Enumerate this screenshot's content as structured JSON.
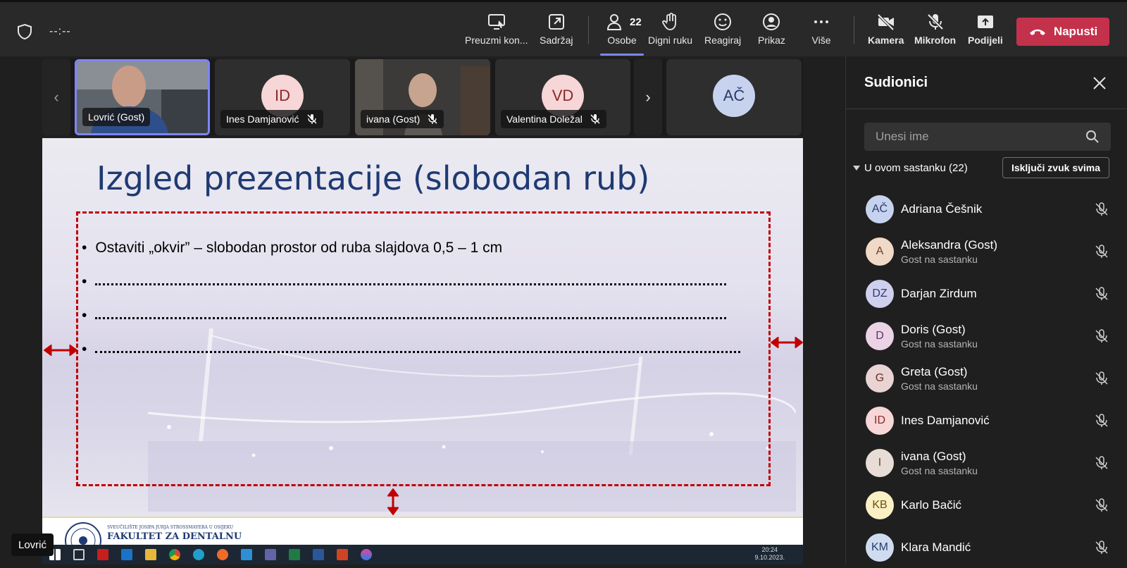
{
  "topbar": {
    "timer": "--:--",
    "buttons": [
      {
        "label": "Preuzmi kon...",
        "icon": "take-control-icon"
      },
      {
        "label": "Sadržaj",
        "icon": "share-tray-icon"
      },
      {
        "label": "Osobe",
        "icon": "people-icon",
        "count": "22"
      },
      {
        "label": "Digni ruku",
        "icon": "raise-hand-icon"
      },
      {
        "label": "Reagiraj",
        "icon": "smile-icon"
      },
      {
        "label": "Prikaz",
        "icon": "view-icon"
      },
      {
        "label": "Više",
        "icon": "more-icon"
      },
      {
        "label": "Kamera",
        "icon": "camera-off-icon"
      },
      {
        "label": "Mikrofon",
        "icon": "mic-off-icon"
      },
      {
        "label": "Podijeli",
        "icon": "share-icon"
      }
    ],
    "leave_label": "Napusti",
    "leave_color": "#c4314b"
  },
  "tiles": [
    {
      "name": "Lovrić (Gost)",
      "initials": "",
      "muted": false
    },
    {
      "name": "Ines Damjanović",
      "initials": "ID",
      "muted": true
    },
    {
      "name": "ivana (Gost)",
      "initials": "",
      "muted": true
    },
    {
      "name": "Valentina Doležal",
      "initials": "VD",
      "muted": true
    },
    {
      "name": "",
      "initials": "AČ",
      "muted": false
    }
  ],
  "slide": {
    "title": "Izgled prezentacije (slobodan rub)",
    "bullets": [
      "Ostaviti „okvir” – slobodan prostor od ruba slajdova 0,5 – 1 cm",
      "",
      "",
      ""
    ],
    "footer_university": "SVEUČILIŠTE JOSIPA JURJA STROSSMAYERA U OSIJEKU",
    "footer_faculty": "FAKULTET ZA DENTALNU"
  },
  "shared_taskbar": {
    "time": "20:24",
    "date": "9.10.2023."
  },
  "name_overlay": "Lovrić",
  "panel": {
    "title": "Sudionici",
    "search_placeholder": "Unesi ime",
    "section_label": "U ovom sastanku (22)",
    "mute_all_label": "Isključi zvuk svima",
    "people": [
      {
        "initials": "AČ",
        "name": "Adriana Češnik",
        "sub": "",
        "color": "#c7d3ee",
        "text": "#2b3a6b"
      },
      {
        "initials": "A",
        "name": "Aleksandra (Gost)",
        "sub": "Gost na sastanku",
        "color": "#f1d9c8",
        "text": "#6b3d23"
      },
      {
        "initials": "DZ",
        "name": "Darjan Zirdum",
        "sub": "",
        "color": "#cfd0ee",
        "text": "#37386b"
      },
      {
        "initials": "D",
        "name": "Doris (Gost)",
        "sub": "Gost na sastanku",
        "color": "#ead3e6",
        "text": "#6b2f60"
      },
      {
        "initials": "G",
        "name": "Greta (Gost)",
        "sub": "Gost na sastanku",
        "color": "#ead3d3",
        "text": "#6b2f2f"
      },
      {
        "initials": "ID",
        "name": "Ines Damjanović",
        "sub": "",
        "color": "#f6d6d6",
        "text": "#8a2a2a"
      },
      {
        "initials": "I",
        "name": "ivana (Gost)",
        "sub": "Gost na sastanku",
        "color": "#e8ddd6",
        "text": "#5b463a"
      },
      {
        "initials": "KB",
        "name": "Karlo Bačić",
        "sub": "",
        "color": "#fbefc4",
        "text": "#6b5310"
      },
      {
        "initials": "KM",
        "name": "Klara Mandić",
        "sub": "",
        "color": "#cfdcf0",
        "text": "#27406b"
      }
    ]
  }
}
